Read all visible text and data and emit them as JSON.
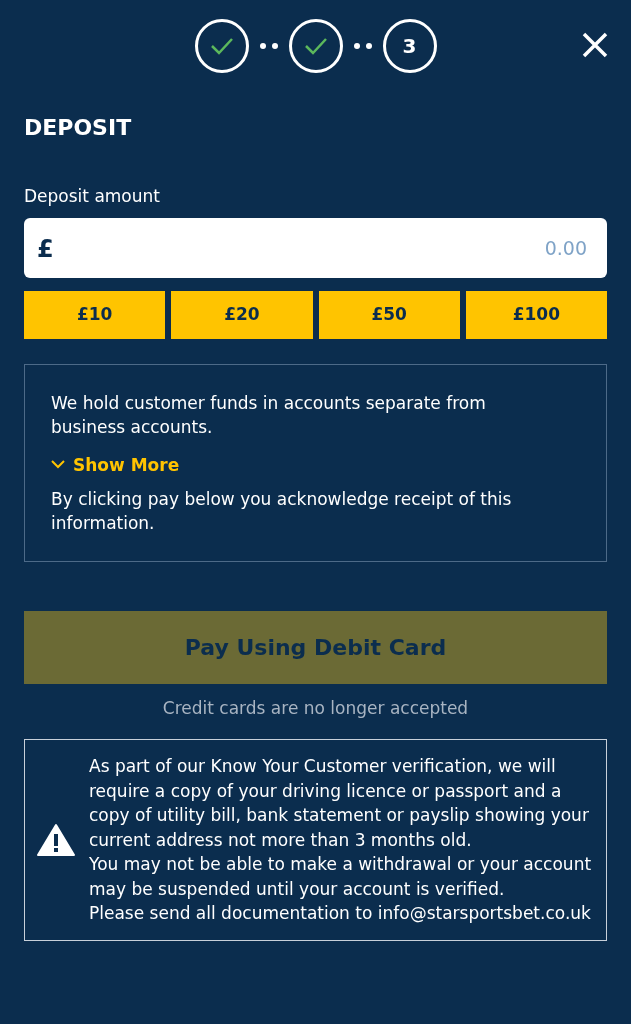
{
  "steps": [
    {
      "completed": true
    },
    {
      "completed": true
    },
    {
      "completed": false,
      "label": "3"
    }
  ],
  "title": "DEPOSIT",
  "amount_field": {
    "label": "Deposit amount",
    "currency": "£",
    "placeholder": "0.00"
  },
  "quick_amounts": [
    "£10",
    "£20",
    "£50",
    "£100"
  ],
  "info": {
    "text": "We hold customer funds in accounts separate from business accounts.",
    "toggle": "Show More",
    "expanded": false,
    "note": "By clicking pay below you acknowledge receipt of this information."
  },
  "pay_button": {
    "label": "Pay Using Debit Card",
    "disabled": true
  },
  "card_note": "Credit cards are no longer accepted",
  "warning": {
    "lines": [
      "As part of our Know Your Customer verification, we will require a copy of your driving licence or passport and a copy of utility bill, bank statement or payslip showing your current address not more than 3 months old.",
      "You may not be able to make a withdrawal or your account may be suspended until your account is verified.",
      "Please send all documentation to info@starsportsbet.co.uk"
    ]
  }
}
